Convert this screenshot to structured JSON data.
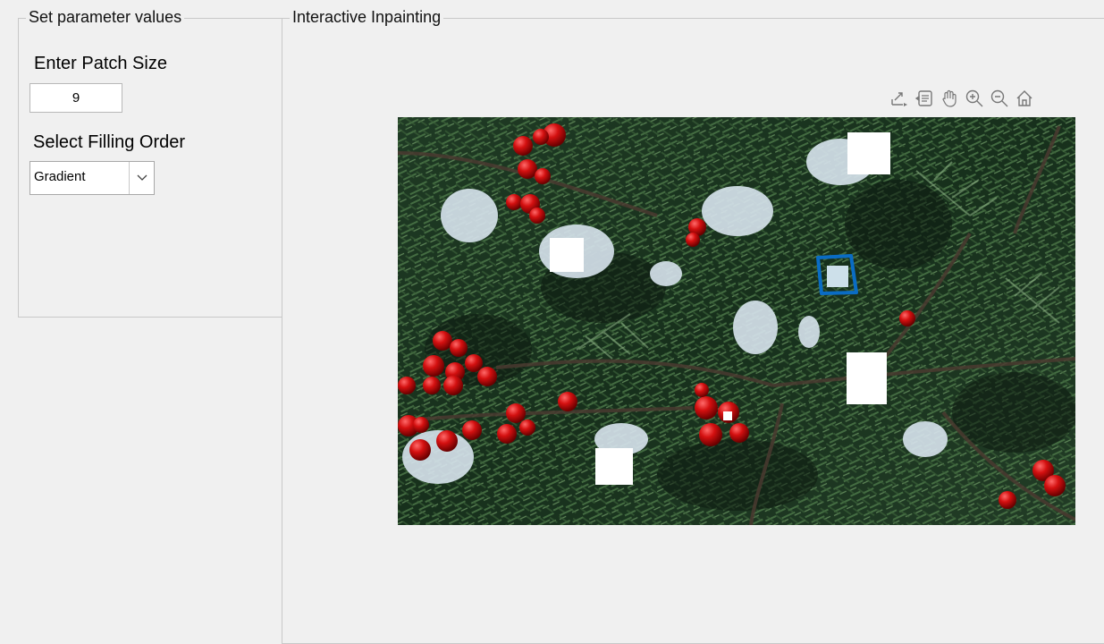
{
  "params_panel": {
    "title": "Set parameter values",
    "patch_size_label": "Enter Patch Size",
    "patch_size_value": "9",
    "filling_order_label": "Select Filling Order",
    "filling_order_value": "Gradient"
  },
  "inpaint_panel": {
    "title": "Interactive Inpainting",
    "toolbar": [
      "export-icon",
      "data-tips-icon",
      "pan-icon",
      "zoom-in-icon",
      "zoom-out-icon",
      "home-icon"
    ]
  },
  "image": {
    "content": "holly branches with red berries and snow",
    "mask_color": "#ffffff",
    "selection_color": "#0a6cc4"
  }
}
